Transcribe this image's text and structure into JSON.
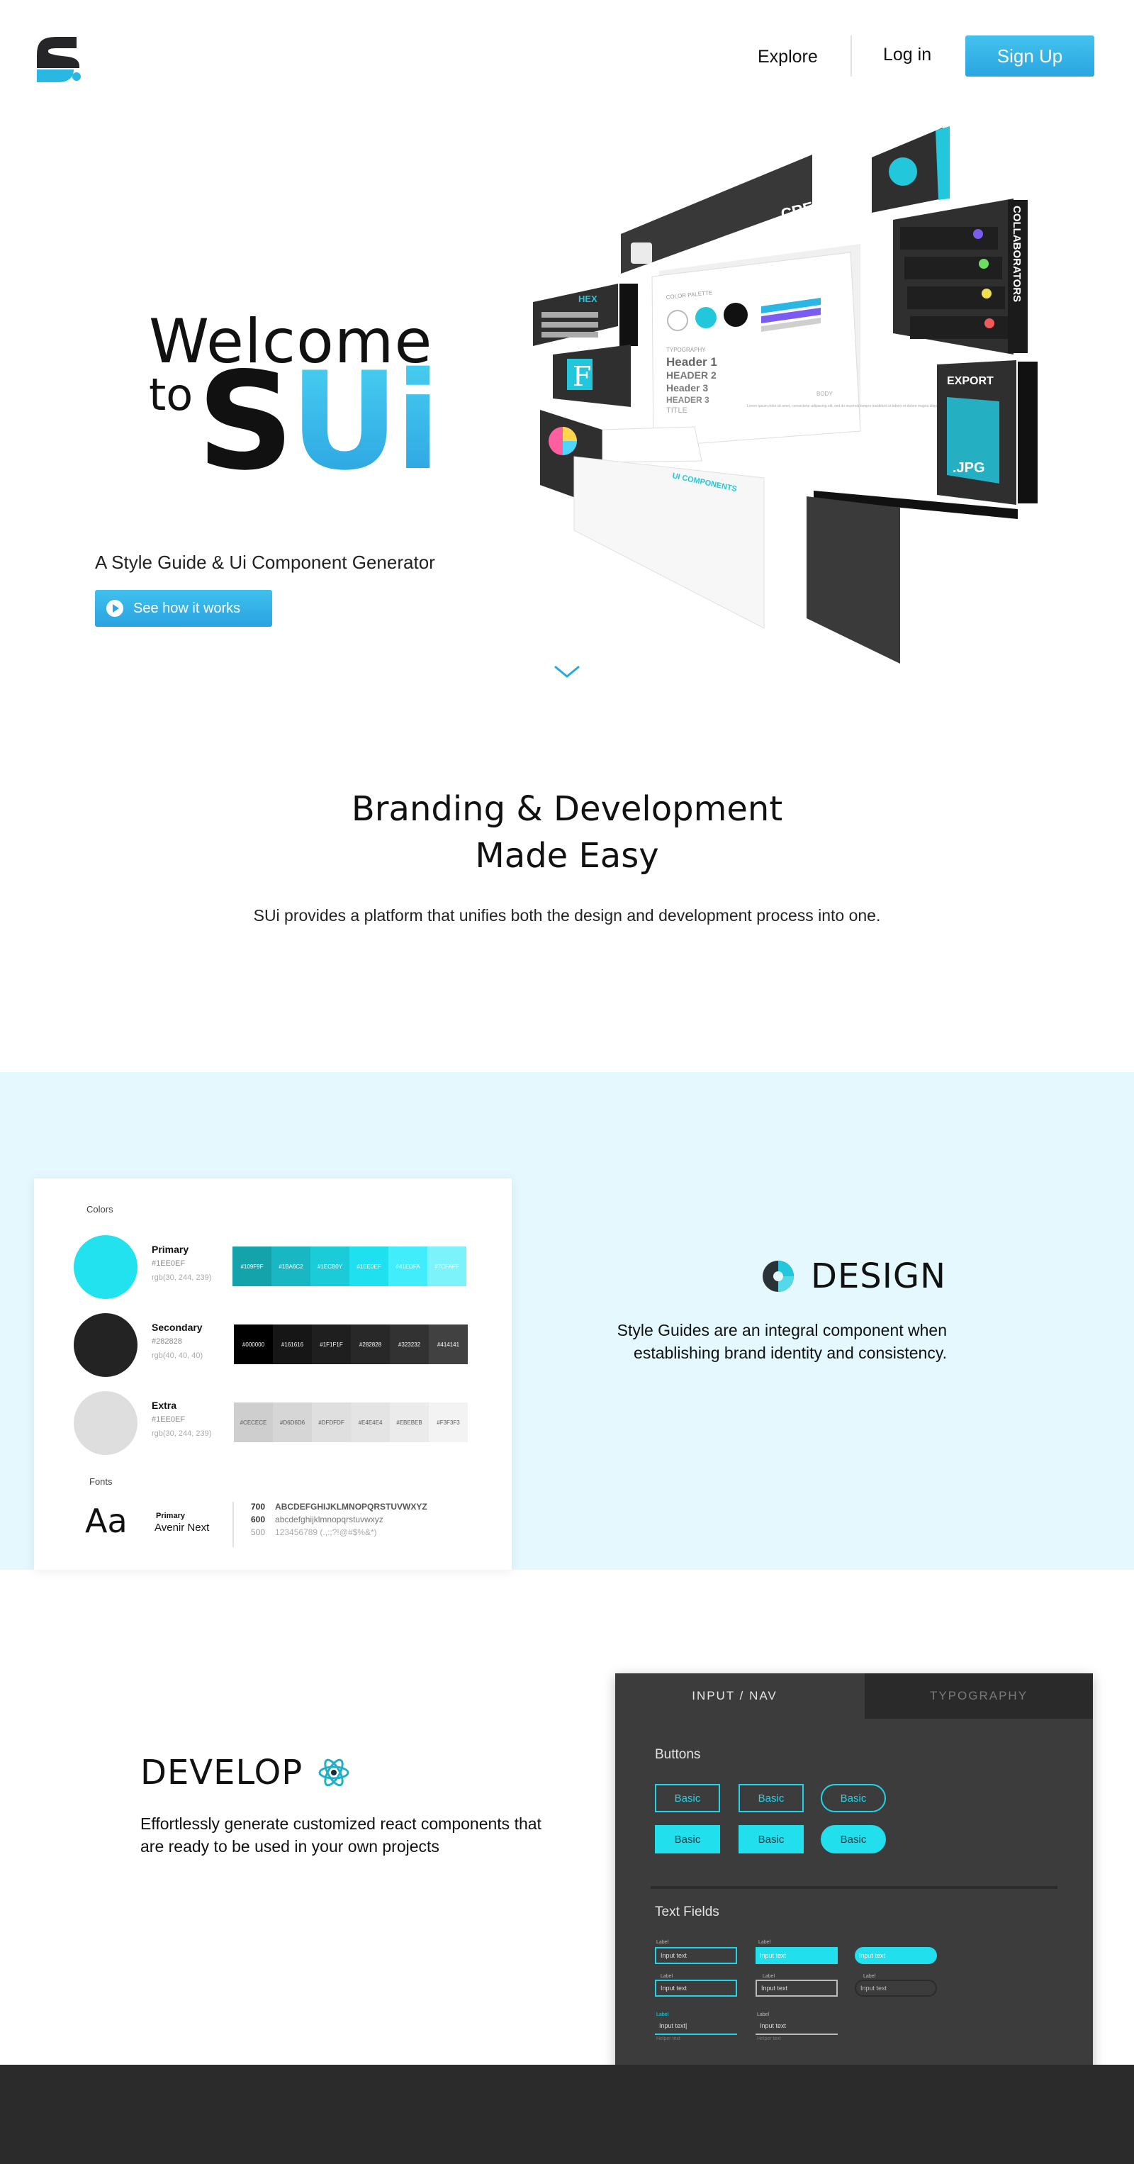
{
  "nav": {
    "explore": "Explore",
    "login": "Log in",
    "signup": "Sign Up"
  },
  "hero": {
    "welcome": "Welcome",
    "to": "to",
    "brand_s": "S",
    "brand_ui": "Ui",
    "tagline": "A Style Guide & Ui Component Generator",
    "cta": "See how it works",
    "illustration": {
      "create": "CREATE",
      "collaborators": "COLLABORATORS",
      "hex": "HEX",
      "export": "EXPORT",
      "jpg": ".JPG",
      "ui_components": "UI COMPONENTS",
      "color_palette": "COLOR PALETTE",
      "typography": "TYPOGRAPHY",
      "header_1": "Header 1",
      "header_2": "HEADER 2",
      "header_3": "Header 3",
      "header_3b": "HEADER 3",
      "title": "TITLE",
      "body": "BODY",
      "lorem": "Lorem ipsum dolor sit amet, consectetur adipiscing elit, sed do eiusmod tempor incididunt ut labore et dolore magna aliqua"
    }
  },
  "branding": {
    "title_line1": "Branding & Development",
    "title_line2": "Made Easy",
    "text": "SUi provides a platform that unifies both the design and development process into one."
  },
  "style_guide": {
    "colors_label": "Colors",
    "colors": [
      {
        "name": "Primary",
        "hex": "#1EE0EF",
        "rgb": "rgb(30, 244, 239)",
        "swatch": "#22e2f0",
        "shades": [
          {
            "label": "#109F9F",
            "color": "#14a3ab"
          },
          {
            "label": "#1BA6C2",
            "color": "#19b7c3"
          },
          {
            "label": "#1ECB0Y",
            "color": "#1ccbd8"
          },
          {
            "label": "#1EE0EF",
            "color": "#1ee0ef"
          },
          {
            "label": "#41EDFA",
            "color": "#41edfa"
          },
          {
            "label": "#7CFAFF",
            "color": "#7cf3fb"
          }
        ]
      },
      {
        "name": "Secondary",
        "hex": "#282828",
        "rgb": "rgb(40, 40, 40)",
        "swatch": "#232323",
        "shades": [
          {
            "label": "#000000",
            "color": "#000000"
          },
          {
            "label": "#161616",
            "color": "#161616"
          },
          {
            "label": "#1F1F1F",
            "color": "#1f1f1f"
          },
          {
            "label": "#282828",
            "color": "#282828"
          },
          {
            "label": "#323232",
            "color": "#323232"
          },
          {
            "label": "#414141",
            "color": "#414141"
          }
        ]
      },
      {
        "name": "Extra",
        "hex": "#1EE0EF",
        "rgb": "rgb(30, 244, 239)",
        "swatch": "#dedede",
        "shades": [
          {
            "label": "#CECECE",
            "color": "#cecece"
          },
          {
            "label": "#D6D6D6",
            "color": "#d6d6d6"
          },
          {
            "label": "#DFDFDF",
            "color": "#dfdfdf"
          },
          {
            "label": "#E4E4E4",
            "color": "#e4e4e4"
          },
          {
            "label": "#EBEBEB",
            "color": "#ebebeb"
          },
          {
            "label": "#F3F3F3",
            "color": "#f3f3f3"
          }
        ]
      }
    ],
    "fonts_label": "Fonts",
    "aa": "Aa",
    "font_role": "Primary",
    "font_name": "Avenir Next",
    "weights": [
      {
        "weight": "700",
        "sample": "ABCDEFGHIJKLMNOPQRSTUVWXYZ"
      },
      {
        "weight": "600",
        "sample": "abcdefghijklmnopqrstuvwxyz"
      },
      {
        "weight": "500",
        "sample": "123456789 (.,:;?!@#$%&*)"
      }
    ]
  },
  "design": {
    "title": "DESIGN",
    "text": "Style Guides are an integral component when establishing brand identity and consistency."
  },
  "develop": {
    "title": "DEVELOP",
    "text": "Effortlessly generate customized react components that are ready to be used in your own projects",
    "tabs": [
      "INPUT / NAV",
      "TYPOGRAPHY"
    ],
    "buttons_label": "Buttons",
    "button_text": "Basic",
    "text_fields_label": "Text Fields",
    "field_label": "Label",
    "field_value": "Input text",
    "field_value_cursor": "Input text|",
    "field_helper": "Helper text"
  },
  "colors": {
    "accent": "#22d4e8",
    "brand_blue": "#2aa5e0",
    "design_bg": "#e4f8fd",
    "footer": "#2b2b2c"
  }
}
